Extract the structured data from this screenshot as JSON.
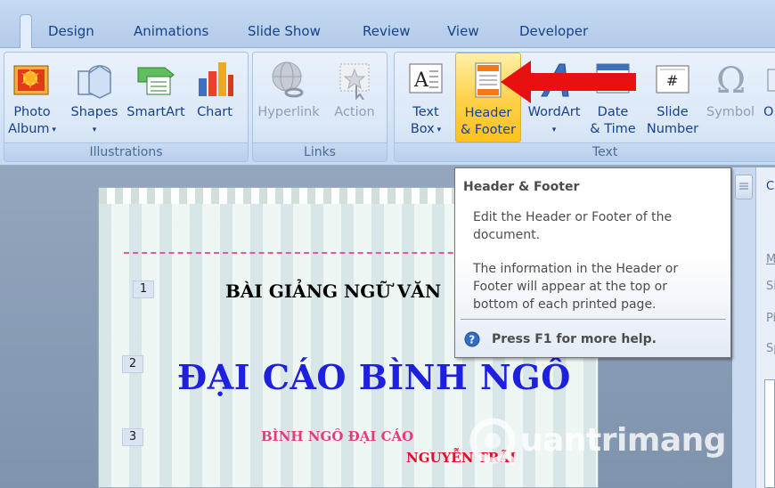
{
  "tabs": [
    "Design",
    "Animations",
    "Slide Show",
    "Review",
    "View",
    "Developer"
  ],
  "groups": {
    "illustrations": {
      "label": "Illustrations",
      "buttons": [
        {
          "line1": "Photo",
          "line2": "Album",
          "dropdown": true,
          "icon": "photo-album-icon"
        },
        {
          "line1": "Shapes",
          "line2": "",
          "dropdown": true,
          "icon": "shapes-icon"
        },
        {
          "line1": "SmartArt",
          "line2": "",
          "dropdown": false,
          "icon": "smartart-icon"
        },
        {
          "line1": "Chart",
          "line2": "",
          "dropdown": false,
          "icon": "chart-icon"
        }
      ]
    },
    "links": {
      "label": "Links",
      "buttons": [
        {
          "line1": "Hyperlink",
          "icon": "hyperlink-icon",
          "disabled": true
        },
        {
          "line1": "Action",
          "icon": "action-icon",
          "disabled": true
        }
      ]
    },
    "text": {
      "label": "Text",
      "buttons": [
        {
          "line1": "Text",
          "line2": "Box",
          "dropdown": true,
          "icon": "text-box-icon"
        },
        {
          "line1": "Header",
          "line2": "& Footer",
          "icon": "header-footer-icon",
          "highlighted": true
        },
        {
          "line1": "WordArt",
          "line2": "",
          "dropdown": true,
          "icon": "wordart-icon"
        },
        {
          "line1": "Date",
          "line2": "& Time",
          "icon": "date-time-icon"
        },
        {
          "line1": "Slide",
          "line2": "Number",
          "icon": "slide-number-icon"
        },
        {
          "line1": "Symbol",
          "line2": "",
          "icon": "symbol-icon",
          "disabled": true
        },
        {
          "line1": "O",
          "line2": "",
          "icon": "object-icon"
        }
      ]
    }
  },
  "tooltip": {
    "title": "Header & Footer",
    "paragraph1": "Edit the Header or Footer of the document.",
    "paragraph2": "The information in the Header or Footer will appear at the top or bottom of each printed page.",
    "help": "Press F1 for more help."
  },
  "slide": {
    "line_numbers": [
      "1",
      "2",
      "3"
    ],
    "line1": "BÀI GIẢNG NGỮ VĂN",
    "line2": "ĐẠI CÁO BÌNH NGÔ",
    "line3": "BÌNH NGÔ ĐẠI CÁO",
    "line4": "NGUYỄN TRÃI"
  },
  "right_pane": {
    "letters": [
      "Cu",
      "M",
      "Si",
      "Pi",
      "Sp"
    ]
  },
  "watermark": "uantrimang",
  "colors": {
    "ribbon_text": "#15428b",
    "highlight": "#ffd24d",
    "arrow": "#e81010",
    "title_blue": "#1f1fe0",
    "pink": "#e8397f",
    "red": "#e0102d"
  }
}
